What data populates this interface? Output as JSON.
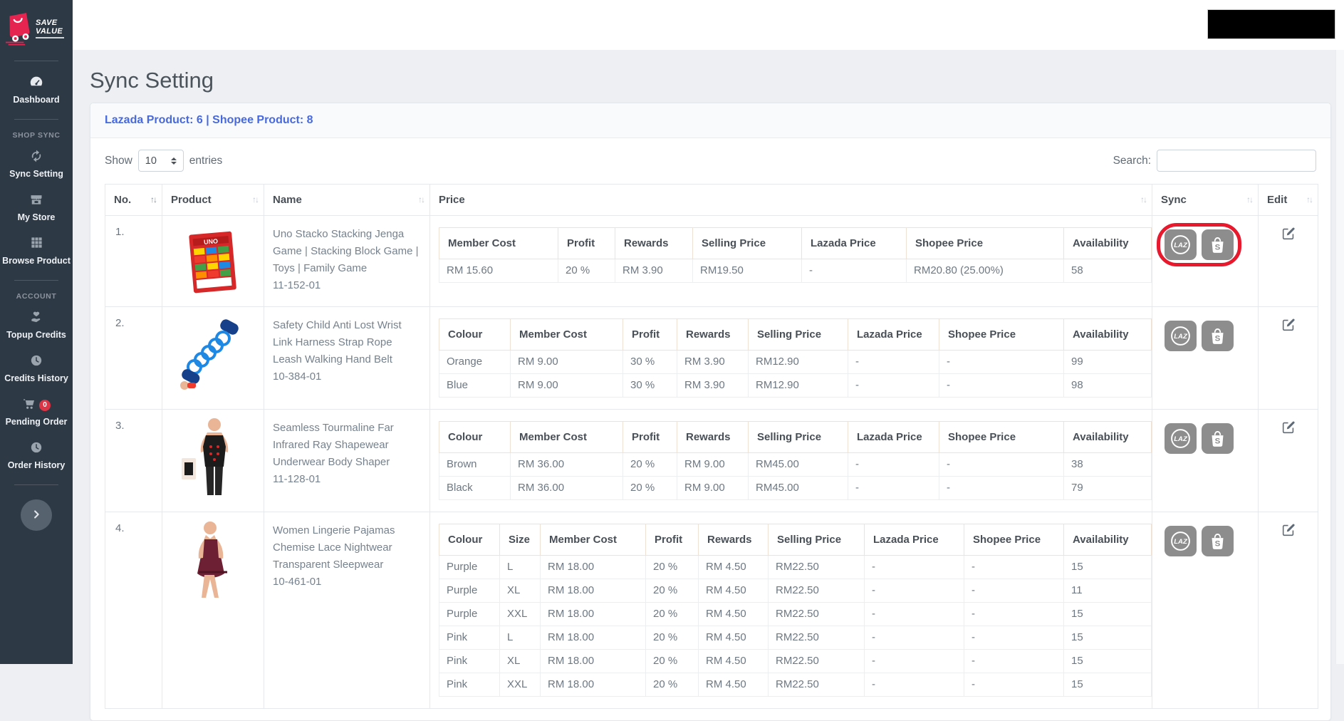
{
  "sidebar": {
    "logo": {
      "line1": "SAVE",
      "line2": "VALUE"
    },
    "dashboard": {
      "label": "Dashboard",
      "icon": "dashboard-gauge-icon"
    },
    "sections": [
      {
        "title": "SHOP SYNC",
        "items": [
          {
            "label": "Sync Setting",
            "icon": "sync-arrows-icon"
          },
          {
            "label": "My Store",
            "icon": "store-icon"
          },
          {
            "label": "Browse Product",
            "icon": "grid-icon"
          }
        ]
      },
      {
        "title": "ACCOUNT",
        "items": [
          {
            "label": "Topup Credits",
            "icon": "hand-heart-icon"
          },
          {
            "label": "Credits History",
            "icon": "clock-icon"
          },
          {
            "label": "Pending Order",
            "icon": "cart-icon",
            "badge": "0"
          },
          {
            "label": "Order History",
            "icon": "clock-icon"
          }
        ]
      }
    ]
  },
  "header": {
    "title": "Sync Setting"
  },
  "card": {
    "summary": "Lazada Product: 6 | Shopee Product: 8"
  },
  "controls": {
    "show_label": "Show",
    "page_size": "10",
    "entries_label": "entries",
    "search_label": "Search:",
    "search_value": ""
  },
  "table": {
    "columns": [
      "No.",
      "Product",
      "Name",
      "Price",
      "Sync",
      "Edit"
    ],
    "rows": [
      {
        "no": "1.",
        "image": "uno-stacko-box",
        "name": "Uno Stacko Stacking Jenga Game | Stacking Block Game | Toys | Family Game",
        "sku": "11-152-01",
        "sync_highlighted": true,
        "price": {
          "columns": [
            "Member Cost",
            "Profit",
            "Rewards",
            "Selling Price",
            "Lazada Price",
            "Shopee Price",
            "Availability"
          ],
          "rows": [
            [
              "RM 15.60",
              "20 %",
              "RM 3.90",
              "RM19.50",
              "-",
              "RM20.80 (25.00%)",
              "58"
            ]
          ]
        }
      },
      {
        "no": "2.",
        "image": "anti-lost-wrist-strap",
        "name": "Safety Child Anti Lost Wrist Link Harness Strap Rope Leash Walking Hand Belt",
        "sku": "10-384-01",
        "sync_highlighted": false,
        "price": {
          "columns": [
            "Colour",
            "Member Cost",
            "Profit",
            "Rewards",
            "Selling Price",
            "Lazada Price",
            "Shopee Price",
            "Availability"
          ],
          "rows": [
            [
              "Orange",
              "RM 9.00",
              "30 %",
              "RM 3.90",
              "RM12.90",
              "-",
              "-",
              "99"
            ],
            [
              "Blue",
              "RM 9.00",
              "30 %",
              "RM 3.90",
              "RM12.90",
              "-",
              "-",
              "98"
            ]
          ]
        }
      },
      {
        "no": "3.",
        "image": "shapewear-body-shaper",
        "name": "Seamless Tourmaline Far Infrared Ray Shapewear Underwear Body Shaper",
        "sku": "11-128-01",
        "sync_highlighted": false,
        "price": {
          "columns": [
            "Colour",
            "Member Cost",
            "Profit",
            "Rewards",
            "Selling Price",
            "Lazada Price",
            "Shopee Price",
            "Availability"
          ],
          "rows": [
            [
              "Brown",
              "RM 36.00",
              "20 %",
              "RM 9.00",
              "RM45.00",
              "-",
              "-",
              "38"
            ],
            [
              "Black",
              "RM 36.00",
              "20 %",
              "RM 9.00",
              "RM45.00",
              "-",
              "-",
              "79"
            ]
          ]
        }
      },
      {
        "no": "4.",
        "image": "lace-nightwear",
        "name": "Women Lingerie Pajamas Chemise Lace Nightwear Transparent Sleepwear",
        "sku": "10-461-01",
        "sync_highlighted": false,
        "price": {
          "columns": [
            "Colour",
            "Size",
            "Member Cost",
            "Profit",
            "Rewards",
            "Selling Price",
            "Lazada Price",
            "Shopee Price",
            "Availability"
          ],
          "rows": [
            [
              "Purple",
              "L",
              "RM 18.00",
              "20 %",
              "RM 4.50",
              "RM22.50",
              "-",
              "-",
              "15"
            ],
            [
              "Purple",
              "XL",
              "RM 18.00",
              "20 %",
              "RM 4.50",
              "RM22.50",
              "-",
              "-",
              "11"
            ],
            [
              "Purple",
              "XXL",
              "RM 18.00",
              "20 %",
              "RM 4.50",
              "RM22.50",
              "-",
              "-",
              "15"
            ],
            [
              "Pink",
              "L",
              "RM 18.00",
              "20 %",
              "RM 4.50",
              "RM22.50",
              "-",
              "-",
              "15"
            ],
            [
              "Pink",
              "XL",
              "RM 18.00",
              "20 %",
              "RM 4.50",
              "RM22.50",
              "-",
              "-",
              "15"
            ],
            [
              "Pink",
              "XXL",
              "RM 18.00",
              "20 %",
              "RM 4.50",
              "RM22.50",
              "-",
              "-",
              "15"
            ]
          ]
        }
      }
    ]
  },
  "colors": {
    "sidebar_bg": "#2e3946",
    "accent_blue": "#4769e0",
    "highlight_red": "#e8192d",
    "subtable_header_bg": "#f8e9dd",
    "brand_red": "#e5254f",
    "badge_red": "#dc3545"
  }
}
